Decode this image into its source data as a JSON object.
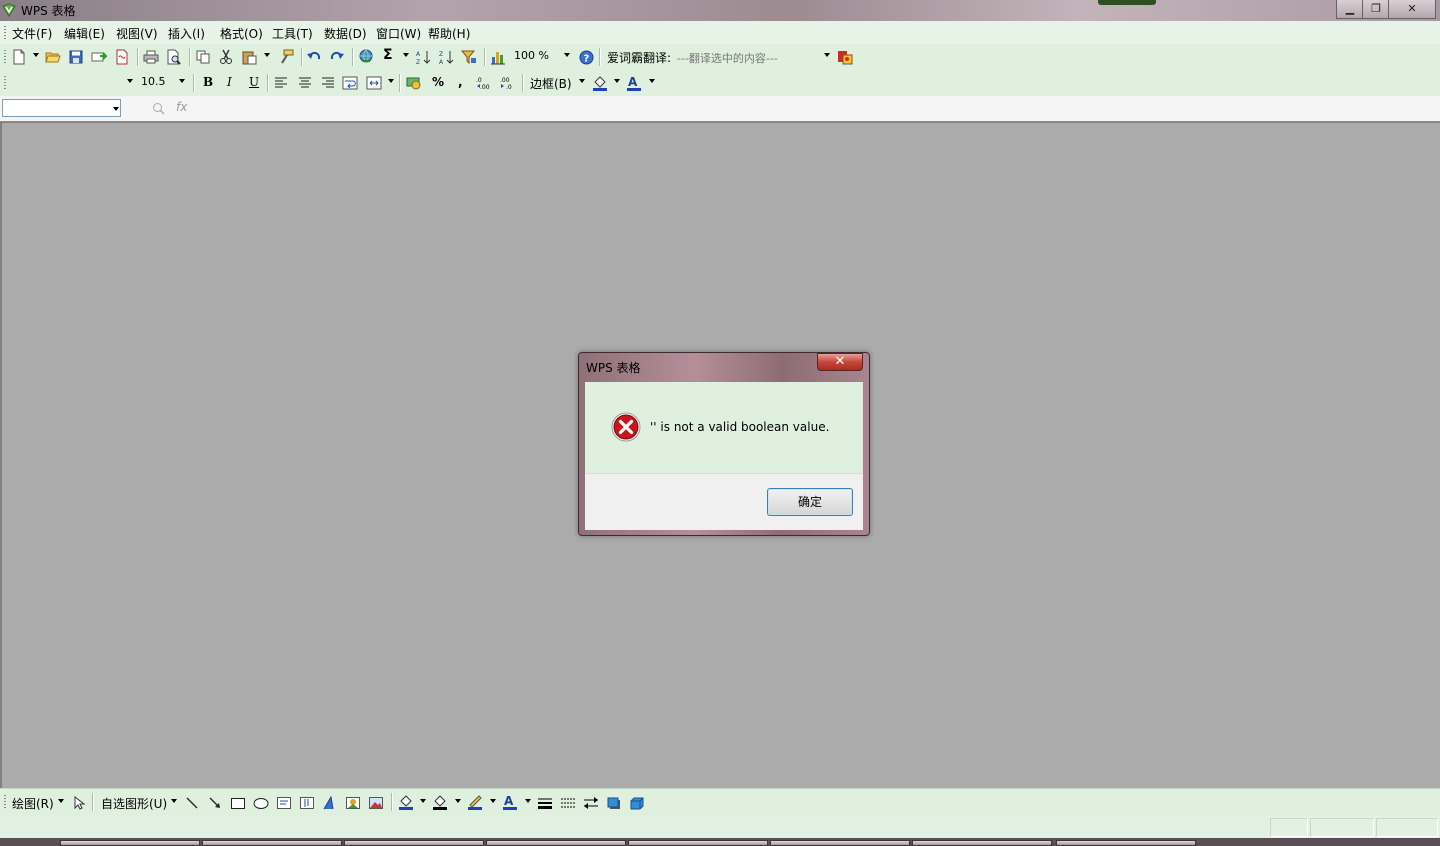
{
  "window": {
    "title": "WPS 表格",
    "min_symbol": "▁",
    "restore_symbol": "❐",
    "close_symbol": "✕"
  },
  "menu": {
    "items": [
      "文件(F)",
      "编辑(E)",
      "视图(V)",
      "插入(I)",
      "格式(O)",
      "工具(T)",
      "数据(D)",
      "窗口(W)",
      "帮助(H)"
    ]
  },
  "toolbar": {
    "sum_symbol": "Σ",
    "zoom_value": "100 %",
    "help_symbol": "?",
    "translate_label": "爱词霸翻译:",
    "translate_placeholder": "---翻译选中的内容---"
  },
  "format_toolbar": {
    "font_name": "",
    "font_size": "10.5",
    "bold": "B",
    "italic": "I",
    "underline": "U",
    "percent": "%",
    "comma": ",",
    "border_label": "边框(B)",
    "font_color_letter": "A"
  },
  "formula_bar": {
    "name_box_value": "",
    "fx_label": "fx"
  },
  "drawing_toolbar": {
    "draw_label": "绘图(R)",
    "autoshape_label": "自选图形(U)",
    "font_color_letter": "A"
  },
  "dialog": {
    "title": "WPS 表格",
    "close_symbol": "✕",
    "message": "'' is not a valid boolean value.",
    "ok_label": "确定"
  },
  "colors": {
    "toolbar_bg": "#dff0df",
    "workspace_bg": "#ababab",
    "error_red": "#c8161d"
  }
}
